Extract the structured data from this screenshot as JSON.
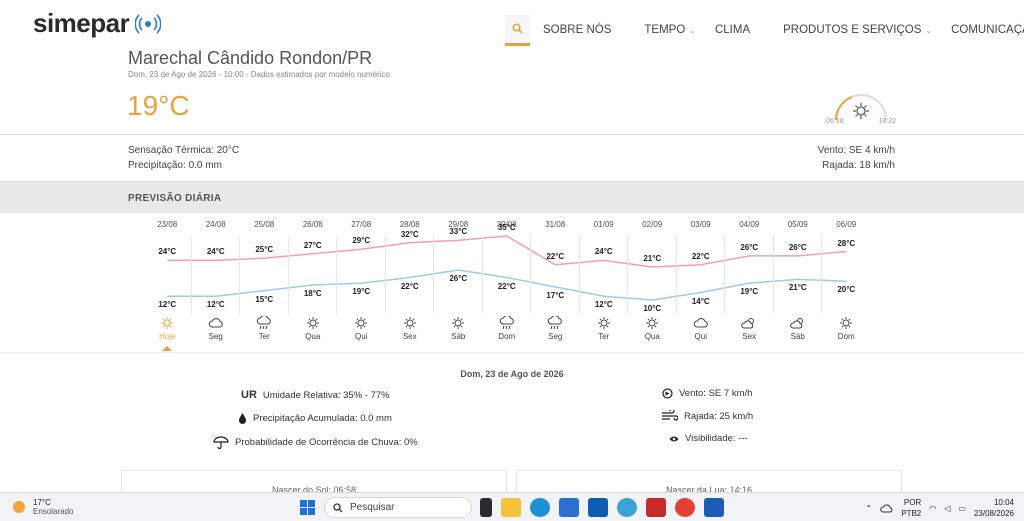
{
  "brand": {
    "name": "simepar"
  },
  "nav": {
    "items": [
      {
        "label": "SOBRE NÓS",
        "chevron": false
      },
      {
        "label": "TEMPO",
        "chevron": true
      },
      {
        "label": "CLIMA",
        "chevron": false
      },
      {
        "label": "PRODUTOS E SERVIÇOS",
        "chevron": true
      },
      {
        "label": "COMUNICAÇÃO",
        "chevron": true
      }
    ]
  },
  "location": {
    "city": "Marechal Cândido Rondon/PR",
    "dateline": "Dom, 23 de Ago de 2026 - 10:00 - Dados estimados por modelo numérico",
    "temperature": "19°C",
    "sunrise": "06:58",
    "sunset": "18:22"
  },
  "extra": {
    "feels": "Sensação Térmica: 20°C",
    "precip": "Precipitação: 0.0 mm",
    "wind": "Vento: SE 4 km/h",
    "gust": "Rajada: 18 km/h"
  },
  "daily": {
    "title": "PREVISÃO DIÁRIA"
  },
  "chart_data": {
    "type": "line",
    "categories": [
      "23/08",
      "24/08",
      "25/08",
      "26/08",
      "27/08",
      "28/08",
      "29/08",
      "30/08",
      "31/08",
      "01/09",
      "02/09",
      "03/09",
      "04/09",
      "05/09",
      "06/09"
    ],
    "day_names": [
      "Hoje",
      "Seg",
      "Ter",
      "Qua",
      "Qui",
      "Sex",
      "Sáb",
      "Dom",
      "Seg",
      "Ter",
      "Qua",
      "Qui",
      "Sex",
      "Sáb",
      "Dom"
    ],
    "icons": [
      "sun",
      "cloud",
      "rain",
      "sun",
      "sun",
      "sun",
      "sun",
      "rain",
      "rain",
      "sun",
      "sun",
      "cloud",
      "partly",
      "partly",
      "sun"
    ],
    "series": [
      {
        "values": [
          24,
          24,
          25,
          27,
          29,
          32,
          33,
          35,
          22,
          24,
          21,
          22,
          26,
          26,
          28
        ],
        "color": "#f2a0a8"
      },
      {
        "values": [
          12,
          12,
          15,
          18,
          19,
          22,
          26,
          22,
          17,
          12,
          10,
          14,
          19,
          21,
          20
        ],
        "color": "#9ccbe9"
      }
    ],
    "unit": "°C"
  },
  "details": {
    "date": "Dom, 23 de Ago de 2026",
    "ur_abbr": "UR",
    "humidity": "Umidade Relativa: 35% - 77%",
    "precip": "Precipitação Acumulada: 0.0 mm",
    "rain_prob": "Probabilidade de Ocorrência de Chuva: 0%",
    "wind": "Vento: SE 7 km/h",
    "gust": "Rajada: 25 km/h",
    "visibility": "Visibilidade: ---",
    "card_sun": "Nascer do Sol: 06:58",
    "card_moon": "Nascer da Lua: 14:16"
  },
  "taskbar": {
    "weather_temp": "17°C",
    "weather_desc": "Ensolarado",
    "search": "Pesquisar",
    "lang1": "POR",
    "lang2": "PTB2",
    "time": "10:04",
    "date": "23/08/2026"
  }
}
